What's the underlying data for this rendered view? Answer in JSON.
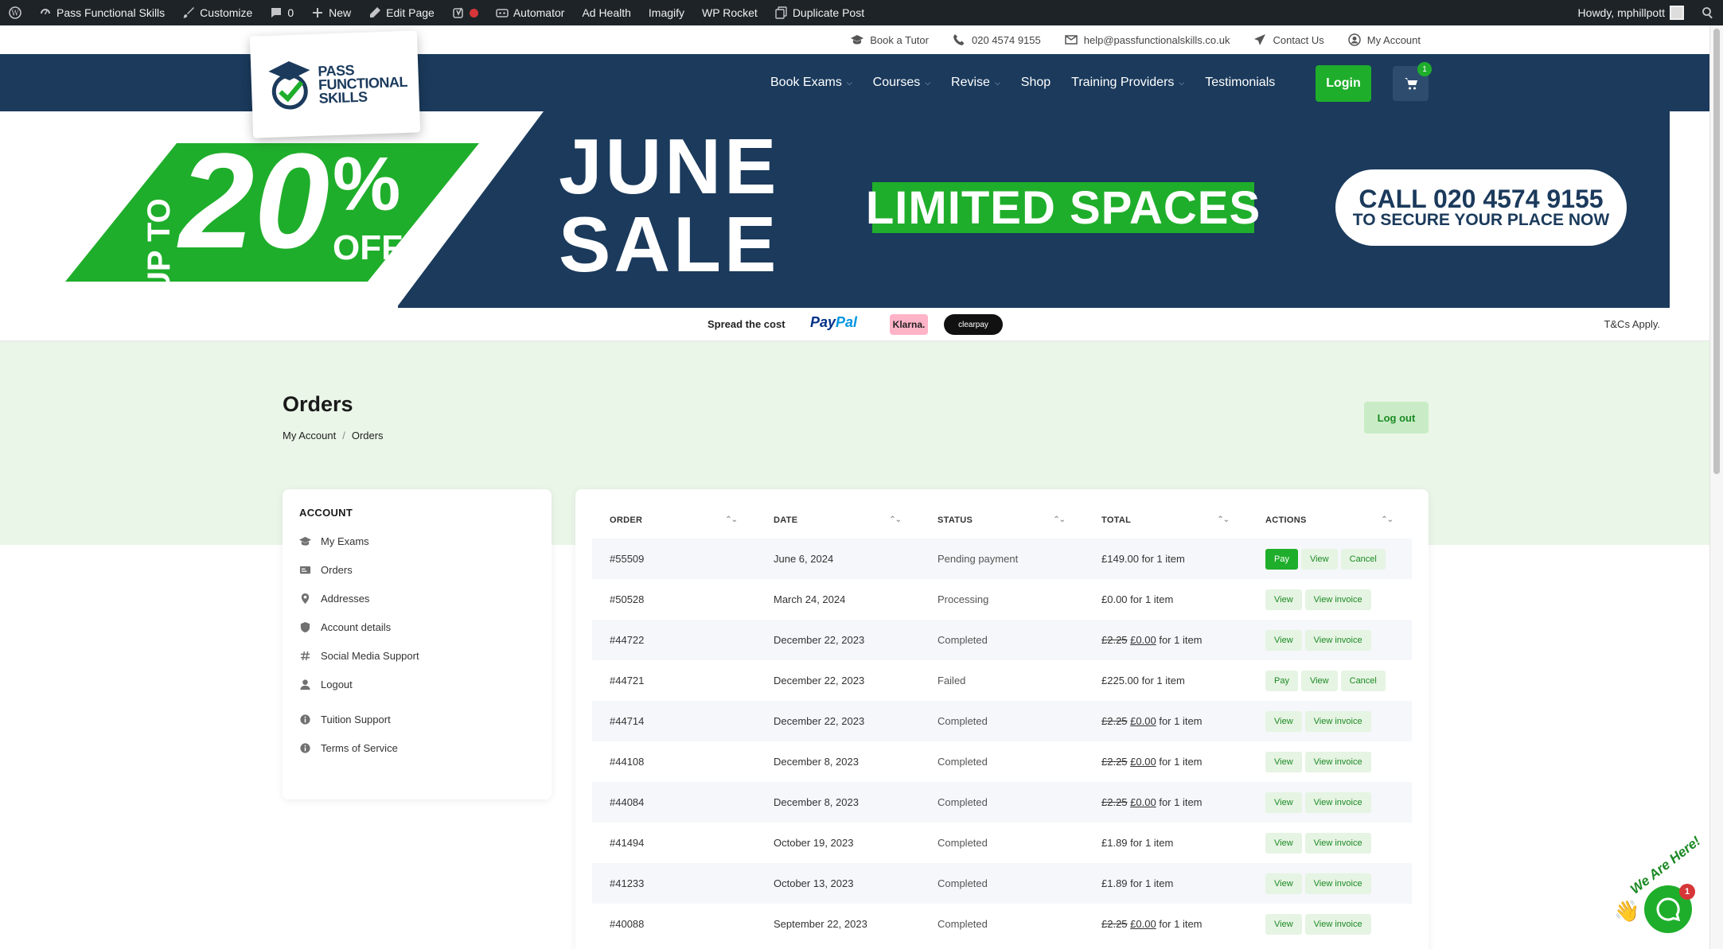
{
  "adminbar": {
    "items": [
      "Pass Functional Skills",
      "Customize",
      "0",
      "New",
      "Edit Page",
      "Automator",
      "Ad Health",
      "Imagify",
      "WP Rocket",
      "Duplicate Post"
    ],
    "greeting": "Howdy, mphillpott"
  },
  "infobar": {
    "tutor": "Book a Tutor",
    "phone": "020 4574 9155",
    "email": "help@passfunctionalskills.co.uk",
    "contact": "Contact Us",
    "account": "My Account"
  },
  "logo": {
    "line1": "PASS",
    "line2": "FUNCTIONAL",
    "line3": "SKILLS"
  },
  "nav": {
    "items": [
      {
        "label": "Book Exams",
        "dropdown": true
      },
      {
        "label": "Courses",
        "dropdown": true
      },
      {
        "label": "Revise",
        "dropdown": true
      },
      {
        "label": "Shop",
        "dropdown": false
      },
      {
        "label": "Training Providers",
        "dropdown": true
      },
      {
        "label": "Testimonials",
        "dropdown": false
      }
    ],
    "login": "Login",
    "cart_count": "1"
  },
  "banner": {
    "upto": "UP TO",
    "big": "20",
    "pct": "%",
    "off": "OFF",
    "june": "JUNE",
    "sale": "SALE",
    "limited": "LIMITED SPACES",
    "call1": "CALL 020 4574 9155",
    "call2": "TO SECURE YOUR PLACE NOW"
  },
  "strip": {
    "spread": "Spread the cost",
    "paypal_a": "Pay",
    "paypal_b": "Pal",
    "klarna": "Klarna.",
    "clearpay": "clearpay",
    "tcs": "T&Cs Apply."
  },
  "page": {
    "title": "Orders",
    "breadcrumb": [
      "My Account",
      "Orders"
    ],
    "logout": "Log out"
  },
  "sidebar": {
    "heading": "ACCOUNT",
    "items": [
      "My Exams",
      "Orders",
      "Addresses",
      "Account details",
      "Social Media Support",
      "Logout"
    ],
    "extra": [
      "Tuition Support",
      "Terms of Service"
    ]
  },
  "table": {
    "headers": [
      "ORDER",
      "DATE",
      "STATUS",
      "TOTAL",
      "ACTIONS"
    ],
    "rows": [
      {
        "order": "#55509",
        "date": "June 6, 2024",
        "status": "Pending payment",
        "was": "",
        "total": "£149.00",
        "suffix": " for 1 item",
        "actions": [
          "Pay",
          "View",
          "Cancel"
        ],
        "pay_solid": true
      },
      {
        "order": "#50528",
        "date": "March 24, 2024",
        "status": "Processing",
        "was": "",
        "total": "£0.00",
        "suffix": " for 1 item",
        "actions": [
          "View",
          "View invoice"
        ],
        "pay_solid": false
      },
      {
        "order": "#44722",
        "date": "December 22, 2023",
        "status": "Completed",
        "was": "£2.25",
        "total": "£0.00",
        "suffix": " for 1 item",
        "actions": [
          "View",
          "View invoice"
        ],
        "pay_solid": false
      },
      {
        "order": "#44721",
        "date": "December 22, 2023",
        "status": "Failed",
        "was": "",
        "total": "£225.00",
        "suffix": " for 1 item",
        "actions": [
          "Pay",
          "View",
          "Cancel"
        ],
        "pay_solid": false
      },
      {
        "order": "#44714",
        "date": "December 22, 2023",
        "status": "Completed",
        "was": "£2.25",
        "total": "£0.00",
        "suffix": " for 1 item",
        "actions": [
          "View",
          "View invoice"
        ],
        "pay_solid": false
      },
      {
        "order": "#44108",
        "date": "December 8, 2023",
        "status": "Completed",
        "was": "£2.25",
        "total": "£0.00",
        "suffix": " for 1 item",
        "actions": [
          "View",
          "View invoice"
        ],
        "pay_solid": false
      },
      {
        "order": "#44084",
        "date": "December 8, 2023",
        "status": "Completed",
        "was": "£2.25",
        "total": "£0.00",
        "suffix": " for 1 item",
        "actions": [
          "View",
          "View invoice"
        ],
        "pay_solid": false
      },
      {
        "order": "#41494",
        "date": "October 19, 2023",
        "status": "Completed",
        "was": "",
        "total": "£1.89",
        "suffix": " for 1 item",
        "actions": [
          "View",
          "View invoice"
        ],
        "pay_solid": false
      },
      {
        "order": "#41233",
        "date": "October 13, 2023",
        "status": "Completed",
        "was": "",
        "total": "£1.89",
        "suffix": " for 1 item",
        "actions": [
          "View",
          "View invoice"
        ],
        "pay_solid": false
      },
      {
        "order": "#40088",
        "date": "September 22, 2023",
        "status": "Completed",
        "was": "£2.25",
        "total": "£0.00",
        "suffix": " for 1 item",
        "actions": [
          "View",
          "View invoice"
        ],
        "pay_solid": false
      }
    ]
  },
  "chat": {
    "tag": "We Are Here!",
    "badge": "1"
  },
  "colors": {
    "navy": "#1b3a5c",
    "green": "#1fae2b",
    "admin": "#1d2327",
    "mint": "#eaf6e8"
  }
}
